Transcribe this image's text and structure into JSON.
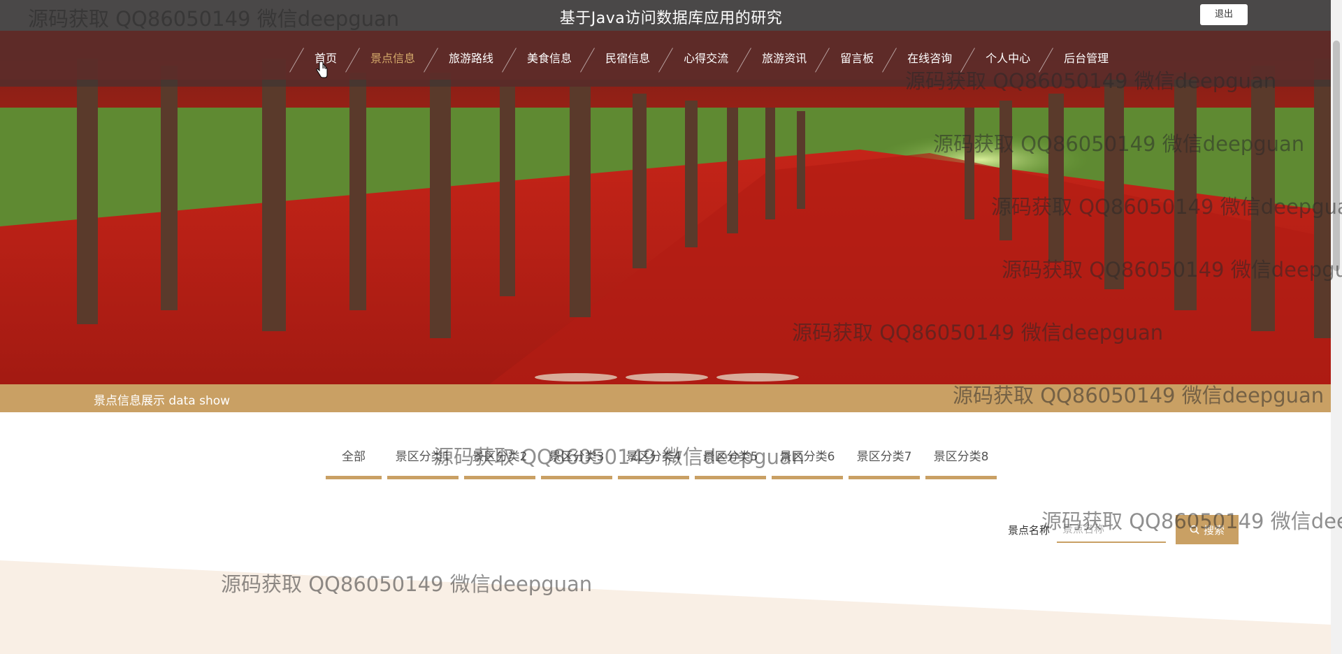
{
  "header": {
    "site_title": "基于Java访问数据库应用的研究",
    "logout_label": "退出"
  },
  "nav": {
    "items": [
      {
        "label": "首页"
      },
      {
        "label": "景点信息"
      },
      {
        "label": "旅游路线"
      },
      {
        "label": "美食信息"
      },
      {
        "label": "民宿信息"
      },
      {
        "label": "心得交流"
      },
      {
        "label": "旅游资讯"
      },
      {
        "label": "留言板"
      },
      {
        "label": "在线咨询"
      },
      {
        "label": "个人中心"
      },
      {
        "label": "后台管理"
      }
    ],
    "active_index": 1
  },
  "carousel": {
    "slide_count": 3
  },
  "section": {
    "title": "景点信息展示  data show"
  },
  "categories": [
    "全部",
    "景区分类1",
    "景区分类2",
    "景区分类3",
    "景区分类4",
    "景区分类5",
    "景区分类6",
    "景区分类7",
    "景区分类8"
  ],
  "search": {
    "label": "景点名称",
    "placeholder": "景点名称",
    "button_label": "搜索"
  },
  "watermarks": [
    "源码获取 QQ86050149 微信deepguan",
    "源码获取 QQ86050149 微信deepguan",
    "源码获取 QQ86050149 微信deepguan",
    "源码获取 QQ86050149 微信deepguan",
    "源码获取 QQ86050149 微信deepguan",
    "源码获取 QQ86050149 微信deepguan",
    "源码获取 QQ86050149 微信deepguan",
    "源码获取 QQ86050149 微信deepguan",
    "源码获取 QQ86050149 微信deepguan",
    "源码获取 QQ86050149 微信deepguan"
  ],
  "colors": {
    "accent": "#c9a064",
    "topbar": "#4a4848",
    "nav_active": "#d4a96a"
  }
}
